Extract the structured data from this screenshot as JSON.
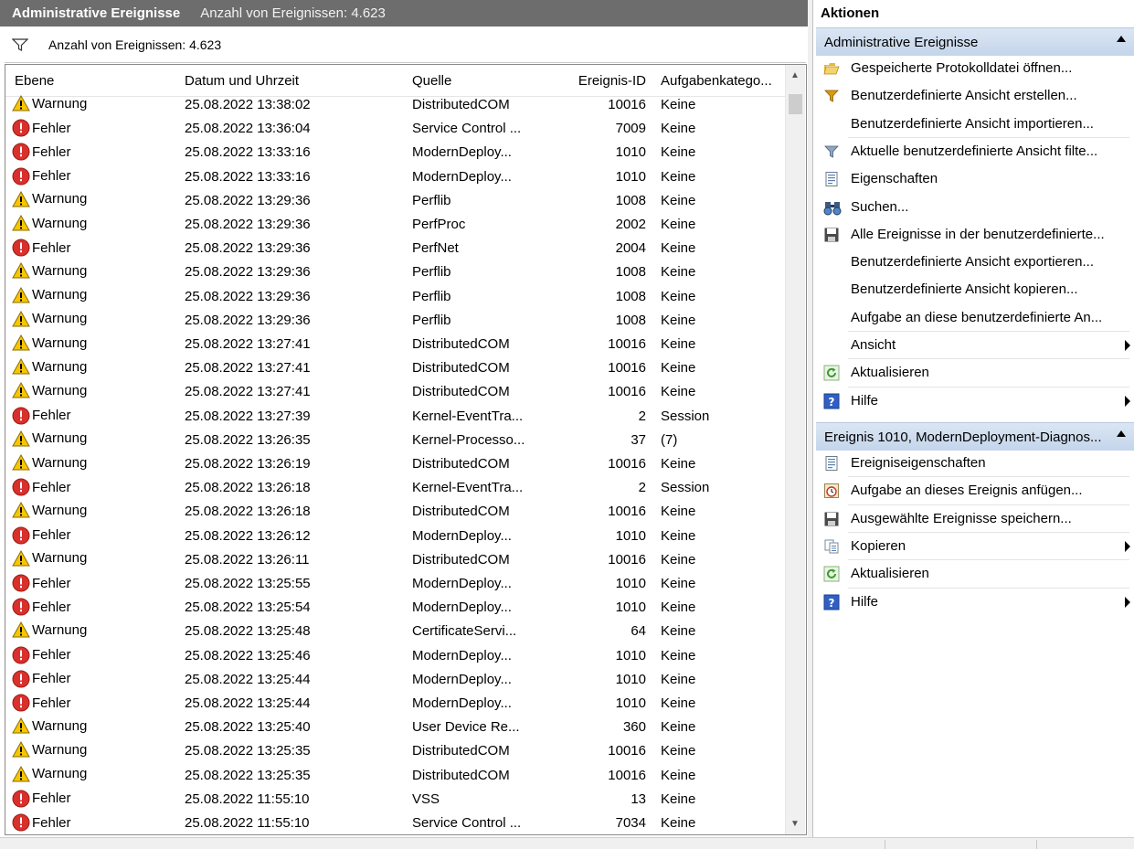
{
  "header": {
    "title": "Administrative Ereignisse",
    "count": "Anzahl von Ereignissen: 4.623"
  },
  "filter": {
    "text": "Anzahl von Ereignissen: 4.623"
  },
  "columns": {
    "level": "Ebene",
    "datetime": "Datum und Uhrzeit",
    "source": "Quelle",
    "event_id": "Ereignis-ID",
    "task": "Aufgabenkatego..."
  },
  "events": [
    {
      "level": "Warnung",
      "type": "warning",
      "datetime": "25.08.2022 13:38:02",
      "source": "DistributedCOM",
      "id": "10016",
      "task": "Keine"
    },
    {
      "level": "Fehler",
      "type": "error",
      "datetime": "25.08.2022 13:36:04",
      "source": "Service Control ...",
      "id": "7009",
      "task": "Keine"
    },
    {
      "level": "Fehler",
      "type": "error",
      "datetime": "25.08.2022 13:33:16",
      "source": "ModernDeploy...",
      "id": "1010",
      "task": "Keine"
    },
    {
      "level": "Fehler",
      "type": "error",
      "datetime": "25.08.2022 13:33:16",
      "source": "ModernDeploy...",
      "id": "1010",
      "task": "Keine"
    },
    {
      "level": "Warnung",
      "type": "warning",
      "datetime": "25.08.2022 13:29:36",
      "source": "Perflib",
      "id": "1008",
      "task": "Keine"
    },
    {
      "level": "Warnung",
      "type": "warning",
      "datetime": "25.08.2022 13:29:36",
      "source": "PerfProc",
      "id": "2002",
      "task": "Keine"
    },
    {
      "level": "Fehler",
      "type": "error",
      "datetime": "25.08.2022 13:29:36",
      "source": "PerfNet",
      "id": "2004",
      "task": "Keine"
    },
    {
      "level": "Warnung",
      "type": "warning",
      "datetime": "25.08.2022 13:29:36",
      "source": "Perflib",
      "id": "1008",
      "task": "Keine"
    },
    {
      "level": "Warnung",
      "type": "warning",
      "datetime": "25.08.2022 13:29:36",
      "source": "Perflib",
      "id": "1008",
      "task": "Keine"
    },
    {
      "level": "Warnung",
      "type": "warning",
      "datetime": "25.08.2022 13:29:36",
      "source": "Perflib",
      "id": "1008",
      "task": "Keine"
    },
    {
      "level": "Warnung",
      "type": "warning",
      "datetime": "25.08.2022 13:27:41",
      "source": "DistributedCOM",
      "id": "10016",
      "task": "Keine"
    },
    {
      "level": "Warnung",
      "type": "warning",
      "datetime": "25.08.2022 13:27:41",
      "source": "DistributedCOM",
      "id": "10016",
      "task": "Keine"
    },
    {
      "level": "Warnung",
      "type": "warning",
      "datetime": "25.08.2022 13:27:41",
      "source": "DistributedCOM",
      "id": "10016",
      "task": "Keine"
    },
    {
      "level": "Fehler",
      "type": "error",
      "datetime": "25.08.2022 13:27:39",
      "source": "Kernel-EventTra...",
      "id": "2",
      "task": "Session"
    },
    {
      "level": "Warnung",
      "type": "warning",
      "datetime": "25.08.2022 13:26:35",
      "source": "Kernel-Processo...",
      "id": "37",
      "task": "(7)"
    },
    {
      "level": "Warnung",
      "type": "warning",
      "datetime": "25.08.2022 13:26:19",
      "source": "DistributedCOM",
      "id": "10016",
      "task": "Keine"
    },
    {
      "level": "Fehler",
      "type": "error",
      "datetime": "25.08.2022 13:26:18",
      "source": "Kernel-EventTra...",
      "id": "2",
      "task": "Session"
    },
    {
      "level": "Warnung",
      "type": "warning",
      "datetime": "25.08.2022 13:26:18",
      "source": "DistributedCOM",
      "id": "10016",
      "task": "Keine"
    },
    {
      "level": "Fehler",
      "type": "error",
      "datetime": "25.08.2022 13:26:12",
      "source": "ModernDeploy...",
      "id": "1010",
      "task": "Keine"
    },
    {
      "level": "Warnung",
      "type": "warning",
      "datetime": "25.08.2022 13:26:11",
      "source": "DistributedCOM",
      "id": "10016",
      "task": "Keine"
    },
    {
      "level": "Fehler",
      "type": "error",
      "datetime": "25.08.2022 13:25:55",
      "source": "ModernDeploy...",
      "id": "1010",
      "task": "Keine"
    },
    {
      "level": "Fehler",
      "type": "error",
      "datetime": "25.08.2022 13:25:54",
      "source": "ModernDeploy...",
      "id": "1010",
      "task": "Keine"
    },
    {
      "level": "Warnung",
      "type": "warning",
      "datetime": "25.08.2022 13:25:48",
      "source": "CertificateServi...",
      "id": "64",
      "task": "Keine"
    },
    {
      "level": "Fehler",
      "type": "error",
      "datetime": "25.08.2022 13:25:46",
      "source": "ModernDeploy...",
      "id": "1010",
      "task": "Keine"
    },
    {
      "level": "Fehler",
      "type": "error",
      "datetime": "25.08.2022 13:25:44",
      "source": "ModernDeploy...",
      "id": "1010",
      "task": "Keine"
    },
    {
      "level": "Fehler",
      "type": "error",
      "datetime": "25.08.2022 13:25:44",
      "source": "ModernDeploy...",
      "id": "1010",
      "task": "Keine"
    },
    {
      "level": "Warnung",
      "type": "warning",
      "datetime": "25.08.2022 13:25:40",
      "source": "User Device Re...",
      "id": "360",
      "task": "Keine"
    },
    {
      "level": "Warnung",
      "type": "warning",
      "datetime": "25.08.2022 13:25:35",
      "source": "DistributedCOM",
      "id": "10016",
      "task": "Keine"
    },
    {
      "level": "Warnung",
      "type": "warning",
      "datetime": "25.08.2022 13:25:35",
      "source": "DistributedCOM",
      "id": "10016",
      "task": "Keine"
    },
    {
      "level": "Fehler",
      "type": "error",
      "datetime": "25.08.2022 11:55:10",
      "source": "VSS",
      "id": "13",
      "task": "Keine"
    },
    {
      "level": "Fehler",
      "type": "error",
      "datetime": "25.08.2022 11:55:10",
      "source": "Service Control ...",
      "id": "7034",
      "task": "Keine"
    }
  ],
  "actions": {
    "title": "Aktionen",
    "section1": {
      "title": "Administrative Ereignisse",
      "items": [
        {
          "label": "Gespeicherte Protokolldatei öffnen...",
          "icon": "folder-open-icon"
        },
        {
          "label": "Benutzerdefinierte Ansicht erstellen...",
          "icon": "filter-create-icon"
        },
        {
          "label": "Benutzerdefinierte Ansicht importieren...",
          "icon": ""
        },
        {
          "label": "Aktuelle benutzerdefinierte Ansicht filte...",
          "icon": "filter-icon"
        },
        {
          "label": "Eigenschaften",
          "icon": "properties-icon"
        },
        {
          "label": "Suchen...",
          "icon": "binoculars-icon"
        },
        {
          "label": "Alle Ereignisse in der benutzerdefinierte...",
          "icon": "save-icon"
        },
        {
          "label": "Benutzerdefinierte Ansicht exportieren...",
          "icon": ""
        },
        {
          "label": "Benutzerdefinierte Ansicht kopieren...",
          "icon": ""
        },
        {
          "label": "Aufgabe an diese benutzerdefinierte An...",
          "icon": ""
        },
        {
          "label": "Ansicht",
          "icon": ""
        },
        {
          "label": "Aktualisieren",
          "icon": "refresh-icon"
        },
        {
          "label": "Hilfe",
          "icon": "help-icon"
        }
      ]
    },
    "section2": {
      "title": "Ereignis 1010, ModernDeployment-Diagnos...",
      "items": [
        {
          "label": "Ereigniseigenschaften",
          "icon": "properties-icon"
        },
        {
          "label": "Aufgabe an dieses Ereignis anfügen...",
          "icon": "task-clock-icon"
        },
        {
          "label": "Ausgewählte Ereignisse speichern...",
          "icon": "save-icon"
        },
        {
          "label": "Kopieren",
          "icon": "copy-icon"
        },
        {
          "label": "Aktualisieren",
          "icon": "refresh-icon"
        },
        {
          "label": "Hilfe",
          "icon": "help-icon"
        }
      ]
    }
  }
}
